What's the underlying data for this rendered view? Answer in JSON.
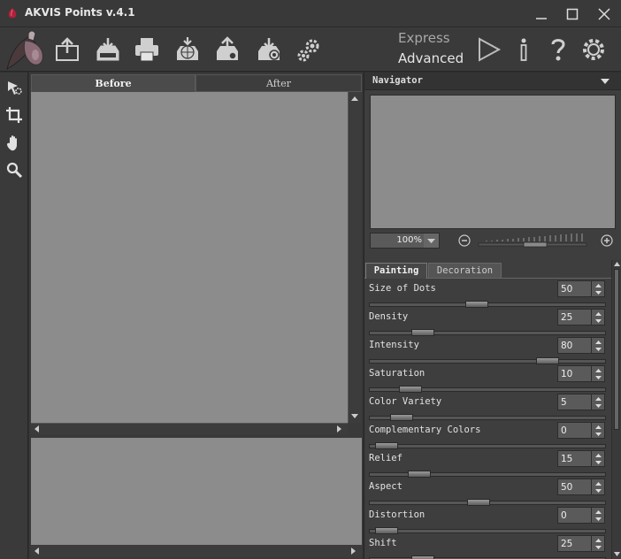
{
  "window": {
    "title": "AKVIS Points v.4.1"
  },
  "toolbar": {
    "mode_express": "Express",
    "mode_advanced": "Advanced",
    "icons": [
      "open-image-icon",
      "save-image-icon",
      "print-icon",
      "publish-icon",
      "share-icon",
      "batch-icon",
      "preferences-icon",
      "run-icon",
      "info-icon",
      "help-icon",
      "settings-icon"
    ]
  },
  "tools": [
    "quick-selection-icon",
    "crop-icon",
    "hand-icon",
    "zoom-icon"
  ],
  "image": {
    "tab_before": "Before",
    "tab_after": "After"
  },
  "navigator": {
    "title": "Navigator",
    "zoom": "100%"
  },
  "params": {
    "tab_painting": "Painting",
    "tab_decoration": "Decoration",
    "items": [
      {
        "label": "Size of Dots",
        "value": "50",
        "level": 0.45
      },
      {
        "label": "Density",
        "value": "25",
        "level": 0.2
      },
      {
        "label": "Intensity",
        "value": "80",
        "level": 0.78
      },
      {
        "label": "Saturation",
        "value": "10",
        "level": 0.14
      },
      {
        "label": "Color Variety",
        "value": "5",
        "level": 0.1
      },
      {
        "label": "Complementary Colors",
        "value": "0",
        "level": 0.03
      },
      {
        "label": "Relief",
        "value": "15",
        "level": 0.18
      },
      {
        "label": "Aspect",
        "value": "50",
        "level": 0.46
      },
      {
        "label": "Distortion",
        "value": "0",
        "level": 0.03
      },
      {
        "label": "Shift",
        "value": "25",
        "level": 0.2
      }
    ]
  },
  "colors": {
    "accent_red": "#b3203a",
    "canvas_gray": "#8c8c8c"
  }
}
